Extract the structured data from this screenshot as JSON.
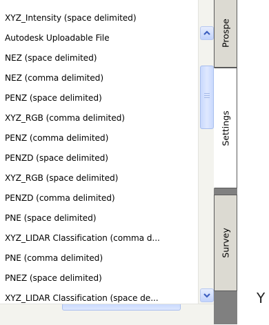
{
  "list": {
    "items": [
      "XYZ_Intensity (space delimited)",
      "Autodesk Uploadable File",
      "NEZ (space delimited)",
      "NEZ (comma delimited)",
      "PENZ (space delimited)",
      "XYZ_RGB (comma delimited)",
      "PENZ (comma delimited)",
      "PENZD (space delimited)",
      "XYZ_RGB (space delimited)",
      "PENZD (comma delimited)",
      "PNE (space delimited)",
      "XYZ_LIDAR Classification (comma d...",
      "PNE (comma delimited)",
      "PNEZ (space delimited)",
      "XYZ_LIDAR Classification (space de..."
    ]
  },
  "tabs": {
    "prospector": "Prospe",
    "settings": "Settings",
    "survey": "Survey"
  },
  "right_pane": {
    "glyph": "Y"
  },
  "icons": {
    "scroll_up": "chevron-up-icon",
    "scroll_down": "chevron-down-icon"
  },
  "colors": {
    "scroll_accent": "#c2d3fc",
    "tab_strip": "#808080"
  }
}
